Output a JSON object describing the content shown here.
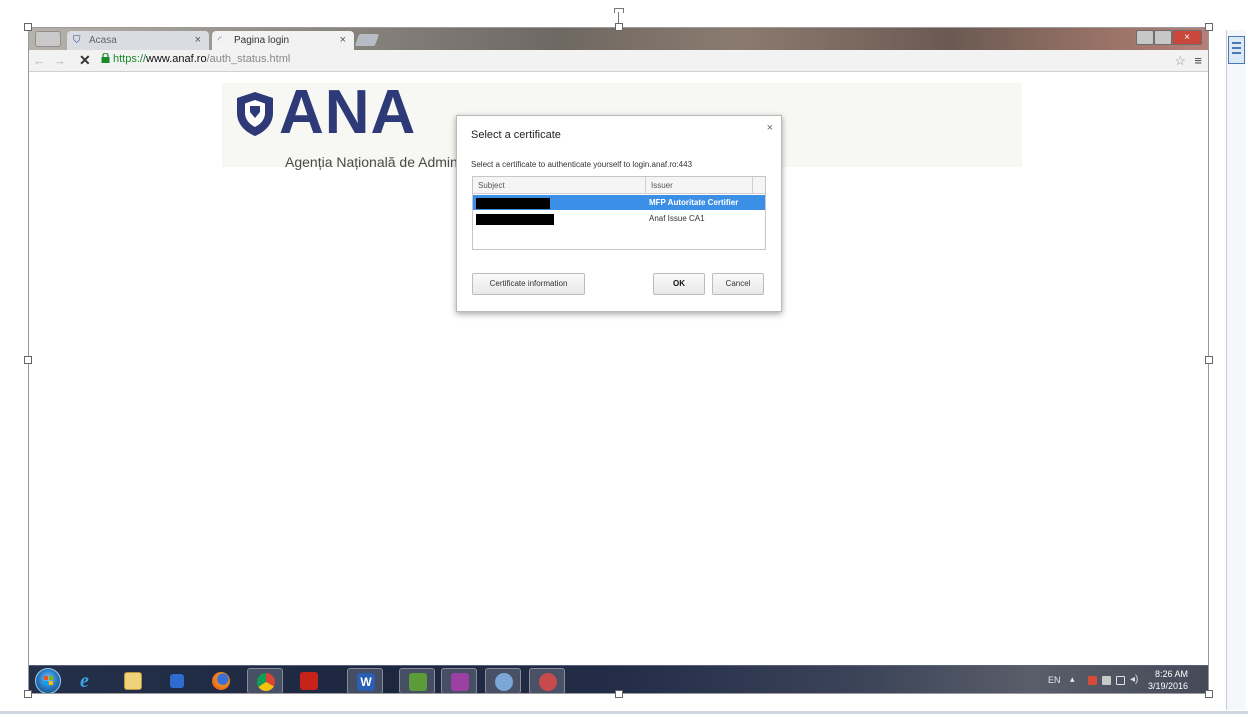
{
  "browser": {
    "tabs": [
      {
        "label": "Acasa",
        "favicon": "shield-icon",
        "active": false
      },
      {
        "label": "Pagina login",
        "favicon": "loading-spinner-icon",
        "active": true
      }
    ],
    "close_glyph": "×",
    "address": {
      "scheme": "https://",
      "host": "www.anaf.ro",
      "path": "/auth_status.html"
    }
  },
  "page": {
    "logo_text": "ANA",
    "logo_subtitle": "Agenția Națională de Administra",
    "colors": {
      "brand": "#2e3a78",
      "selection": "#3b8fe6"
    }
  },
  "dialog": {
    "title": "Select a certificate",
    "description": "Select a certificate to authenticate yourself to login.anaf.ro:443",
    "columns": [
      "Subject",
      "Issuer"
    ],
    "rows": [
      {
        "subject": "",
        "issuer": "MFP Autoritate Certifier",
        "selected": true
      },
      {
        "subject": "",
        "issuer": "Anaf Issue CA1",
        "selected": false
      }
    ],
    "buttons": {
      "info": "Certificate information",
      "ok": "OK",
      "cancel": "Cancel"
    },
    "close_glyph": "×"
  },
  "taskbar": {
    "apps": [
      "ie-icon",
      "explorer-icon",
      "media-player-icon",
      "firefox-icon",
      "chrome-icon",
      "acrobat-icon",
      "word-icon",
      "project-icon",
      "onenote-icon",
      "paint-icon",
      "snipping-icon"
    ],
    "tray": {
      "language": "EN",
      "time": "8:26 AM",
      "date": "3/19/2016"
    }
  }
}
